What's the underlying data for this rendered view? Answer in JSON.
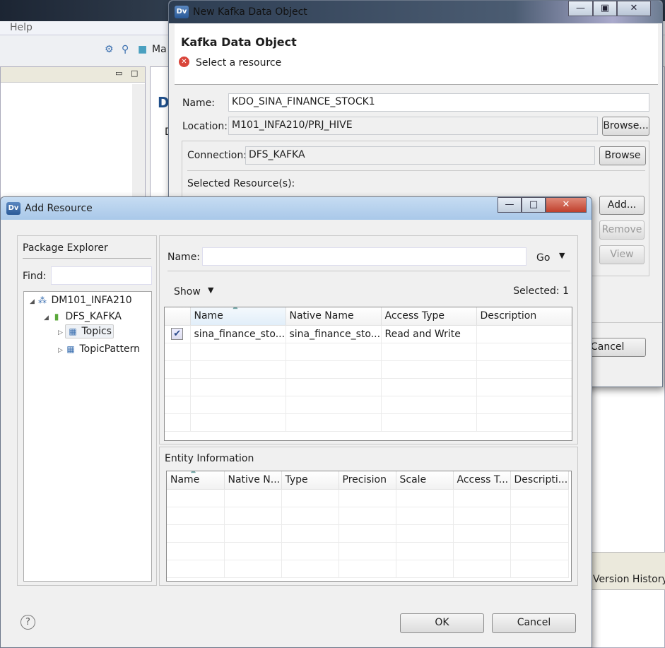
{
  "background_ide": {
    "menu_help": "Help",
    "toolbar_partial": "Ma",
    "editor_partial_title": "D",
    "editor_partial_label": "D",
    "version_history_tab": "Version History"
  },
  "kafka_dialog": {
    "title": "New Kafka Data Object",
    "heading": "Kafka Data Object",
    "message": "Select a resource",
    "name_label": "Name:",
    "name_value": "KDO_SINA_FINANCE_STOCK1",
    "location_label": "Location:",
    "location_value": "M101_INFA210/PRJ_HIVE",
    "location_browse": "Browse...",
    "connection_label": "Connection:",
    "connection_value": "DFS_KAFKA",
    "connection_browse": "Browse",
    "selected_resources_label": "Selected Resource(s):",
    "add_button": "Add...",
    "remove_button": "Remove",
    "view_button": "View",
    "cancel_button": "Cancel"
  },
  "add_resource": {
    "title": "Add Resource",
    "package_explorer": {
      "title": "Package Explorer",
      "find_label": "Find:",
      "find_value": "",
      "tree": [
        {
          "label": "DM101_INFA210",
          "level": 0,
          "expanded": true,
          "icon": "project-icon"
        },
        {
          "label": "DFS_KAFKA",
          "level": 1,
          "expanded": true,
          "icon": "connection-icon"
        },
        {
          "label": "Topics",
          "level": 2,
          "expanded": false,
          "selected": true,
          "icon": "folder-icon"
        },
        {
          "label": "TopicPattern",
          "level": 2,
          "expanded": false,
          "icon": "folder-icon"
        }
      ]
    },
    "name_label": "Name:",
    "name_value": "",
    "go_button": "Go",
    "show_label": "Show",
    "selected_count": "Selected: 1",
    "resources": {
      "columns": [
        "",
        "Name",
        "Native Name",
        "Access Type",
        "Description"
      ],
      "rows": [
        {
          "checked": true,
          "name": "sina_finance_sto...",
          "native_name": "sina_finance_sto...",
          "access_type": "Read and Write",
          "description": ""
        }
      ]
    },
    "entity_info": {
      "title": "Entity Information",
      "columns": [
        "Name",
        "Native N...",
        "Type",
        "Precision",
        "Scale",
        "Access T...",
        "Descripti..."
      ]
    },
    "ok_button": "OK",
    "cancel_button": "Cancel"
  }
}
